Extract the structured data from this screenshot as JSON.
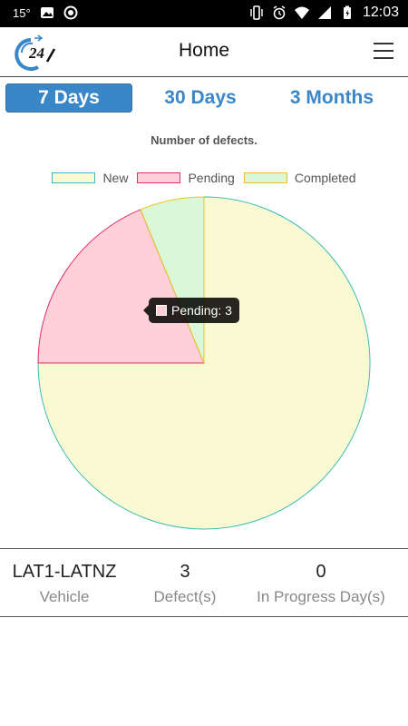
{
  "status_bar": {
    "temperature": "15°",
    "time": "12:03"
  },
  "header": {
    "title": "Home"
  },
  "tabs": [
    {
      "label": "7 Days",
      "active": true
    },
    {
      "label": "30 Days",
      "active": false
    },
    {
      "label": "3 Months",
      "active": false
    }
  ],
  "chart_data": {
    "type": "pie",
    "title": "Number of defects.",
    "categories": [
      "New",
      "Pending",
      "Completed"
    ],
    "values": [
      12,
      3,
      1
    ],
    "colors": {
      "New": {
        "fill": "#fafad2",
        "border": "#3cbcbc"
      },
      "Pending": {
        "fill": "#ffd0d8",
        "border": "#e0306a"
      },
      "Completed": {
        "fill": "#d8f8d8",
        "border": "#f0c020"
      }
    },
    "legend_position": "top",
    "tooltip": "Pending: 3"
  },
  "summary": {
    "vehicle_value": "LAT1-LATNZ",
    "vehicle_label": "Vehicle",
    "defects_value": "3",
    "defects_label": "Defect(s)",
    "days_value": "0",
    "days_label": "In Progress Day(s)"
  }
}
